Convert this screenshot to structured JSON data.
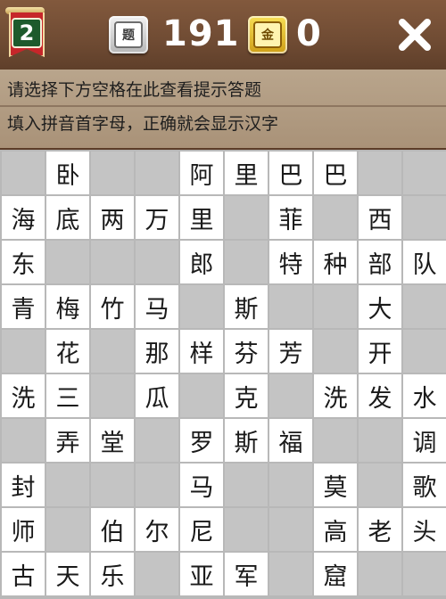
{
  "header": {
    "level": "2",
    "question_chip_icon": "题",
    "question_count": "191",
    "gold_chip_icon": "金",
    "gold_count": "0",
    "close_icon": "close-icon"
  },
  "hints": {
    "line1": "请选择下方空格在此查看提示答题",
    "line2": "填入拼音首字母，正确就会显示汉字"
  },
  "colors": {
    "header_bg": "#6f4b33",
    "hint_bg": "#b09a80",
    "cell_white": "#ffffff",
    "cell_gray": "#c4c4c4",
    "level_flag": "#c6262a",
    "gold_chip": "#e4bd2c"
  },
  "grid": {
    "rows": [
      [
        null,
        "卧",
        null,
        null,
        "阿",
        "里",
        "巴",
        "巴",
        null,
        null
      ],
      [
        "海",
        "底",
        "两",
        "万",
        "里",
        null,
        "菲",
        null,
        "西",
        null
      ],
      [
        "东",
        null,
        null,
        null,
        "郎",
        null,
        "特",
        "种",
        "部",
        "队"
      ],
      [
        "青",
        "梅",
        "竹",
        "马",
        null,
        "斯",
        null,
        null,
        "大",
        null
      ],
      [
        null,
        "花",
        null,
        "那",
        "样",
        "芬",
        "芳",
        null,
        "开",
        null
      ],
      [
        "洗",
        "三",
        null,
        "瓜",
        null,
        "克",
        null,
        "洗",
        "发",
        "水"
      ],
      [
        null,
        "弄",
        "堂",
        null,
        "罗",
        "斯",
        "福",
        null,
        null,
        "调"
      ],
      [
        "封",
        null,
        null,
        null,
        "马",
        null,
        null,
        "莫",
        null,
        "歌"
      ],
      [
        "师",
        null,
        "伯",
        "尔",
        "尼",
        null,
        null,
        "高",
        "老",
        "头"
      ],
      [
        "古",
        "天",
        "乐",
        null,
        "亚",
        "军",
        null,
        "窟",
        null,
        null
      ]
    ]
  }
}
